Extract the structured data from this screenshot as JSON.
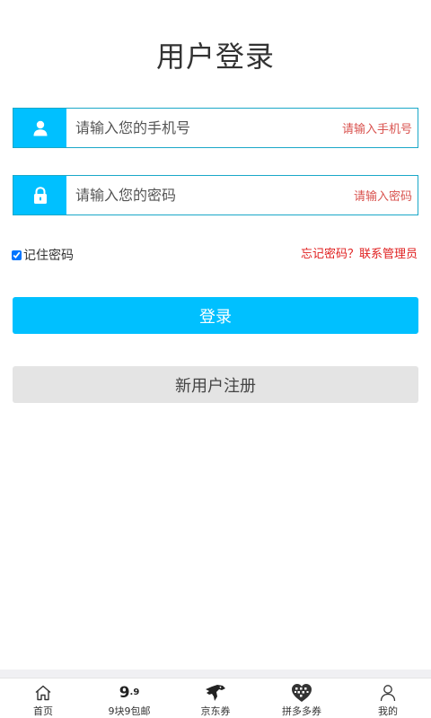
{
  "page": {
    "title": "用户登录"
  },
  "phone": {
    "placeholder": "请输入您的手机号",
    "hint": "请输入手机号",
    "icon": "user-icon"
  },
  "password": {
    "placeholder": "请输入您的密码",
    "hint": "请输入密码",
    "icon": "lock-icon"
  },
  "remember": {
    "label": "记住密码",
    "checked": true
  },
  "forgot": {
    "label": "忘记密码？联系管理员"
  },
  "buttons": {
    "login": "登录",
    "register": "新用户注册"
  },
  "tabbar": {
    "items": [
      {
        "label": "首页",
        "icon": "home-icon"
      },
      {
        "label": "9块9包邮",
        "icon": "nine-nine-icon",
        "icon_text": "9",
        "icon_text_small": ".9"
      },
      {
        "label": "京东券",
        "icon": "jd-dog-icon"
      },
      {
        "label": "拼多多券",
        "icon": "pinduoduo-icon"
      },
      {
        "label": "我的",
        "icon": "profile-icon"
      }
    ]
  },
  "colors": {
    "accent": "#00c0ff",
    "hint": "#d9534f",
    "forgot": "#e02020",
    "register_bg": "#e4e4e4"
  }
}
